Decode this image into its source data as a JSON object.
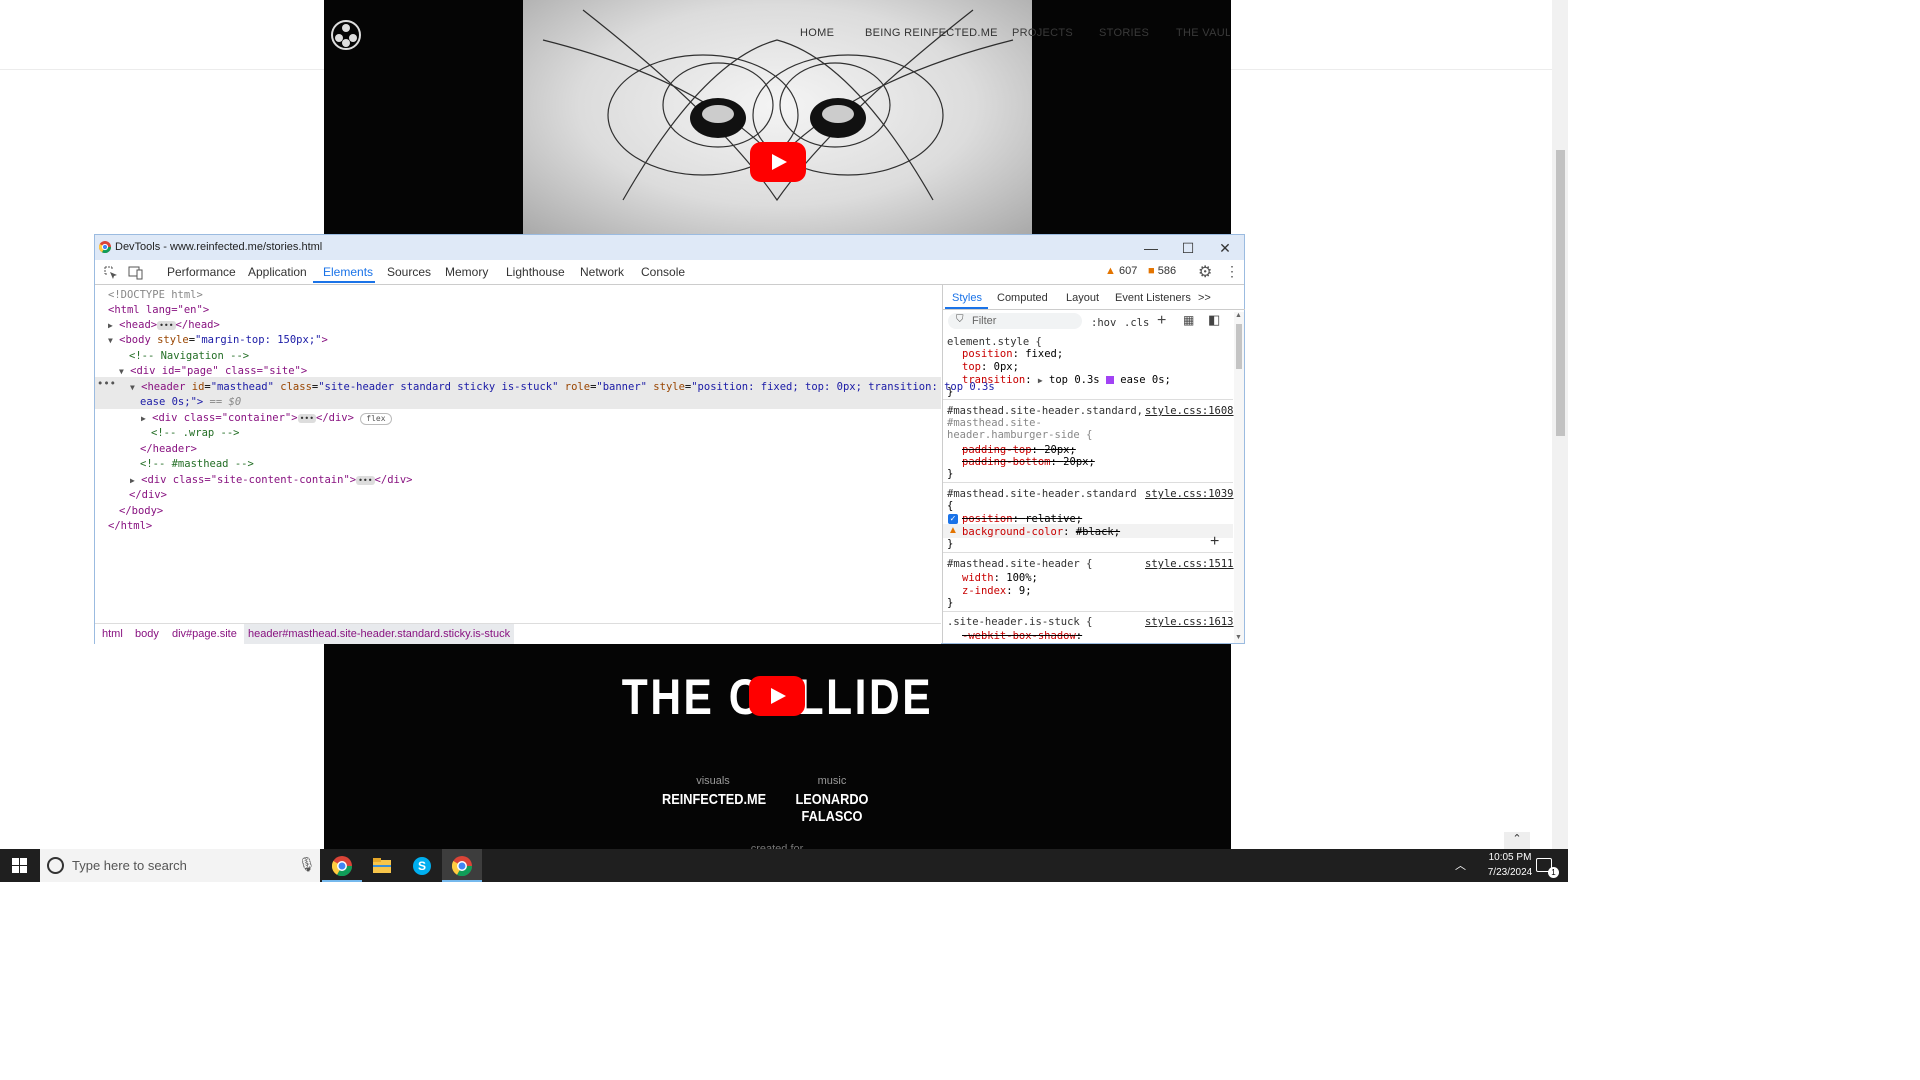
{
  "site": {
    "nav": [
      "HOME",
      "BEING REINFECTED.ME",
      "PROJECTS",
      "STORIES",
      "THE VAULT"
    ],
    "video2": {
      "title": "THE COLLIDE",
      "credits": [
        {
          "role": "visuals",
          "name": "REINFECTED.ME"
        },
        {
          "role": "music",
          "name": "LEONARDO FALASCO"
        }
      ],
      "created_for": "created for"
    }
  },
  "devtools": {
    "window_title": "DevTools - www.reinfected.me/stories.html",
    "tabs": [
      "Performance",
      "Application",
      "Elements",
      "Sources",
      "Memory",
      "Lighthouse",
      "Network",
      "Console"
    ],
    "active_tab": "Elements",
    "warnings_count": "607",
    "issues_count": "586",
    "dom": {
      "doctype": "<!DOCTYPE html>",
      "html_open": "<html lang=\"en\">",
      "head": "<head>",
      "head_close": "</head>",
      "body_open_tag": "<body",
      "body_attr": "style",
      "body_val": "\"margin-top: 150px;\"",
      "comment_nav": "<!-- Navigation -->",
      "div_page": "<div id=\"page\" class=\"site\">",
      "header_tag": "<header",
      "header_id_attr": "id",
      "header_id_val": "\"masthead\"",
      "header_class_attr": "class",
      "header_class_val": "\"site-header standard sticky is-stuck\"",
      "header_role_attr": "role",
      "header_role_val": "\"banner\"",
      "header_style_attr": "style",
      "header_style_val": "\"position: fixed; top: 0px; transition: top 0.3s",
      "header_style_val2": "ease 0s;\">",
      "selected_marker": "== $0",
      "div_container": "<div class=\"container\">",
      "div_close": "</div>",
      "flex_badge": "flex",
      "comment_wrap": "<!-- .wrap -->",
      "header_close": "</header>",
      "comment_masthead": "<!-- #masthead -->",
      "div_content": "<div class=\"site-content-contain\">",
      "div_close2": "</div>",
      "body_close": "</body>",
      "html_close": "</html>"
    },
    "breadcrumb": [
      "html",
      "body",
      "div#page.site",
      "header#masthead.site-header.standard.sticky.is-stuck"
    ],
    "styles": {
      "tabs": [
        "Styles",
        "Computed",
        "Layout",
        "Event Listeners"
      ],
      "more": ">>",
      "filter_placeholder": "Filter",
      "hov": ":hov",
      "cls": ".cls",
      "rules": {
        "element_style": {
          "selector": "element.style {",
          "props": [
            {
              "name": "position",
              "value": "fixed;"
            },
            {
              "name": "top",
              "value": "0px;"
            },
            {
              "name": "transition",
              "value": "top 0.3s",
              "value2": "ease 0s;"
            }
          ]
        },
        "rule2": {
          "selector1": "#masthead.site-header.standard,",
          "selector2": "#masthead.site-",
          "selector3": "header.hamburger-side {",
          "source": "style.css:1608",
          "props": [
            {
              "name": "padding-top",
              "value": "20px;"
            },
            {
              "name": "padding-bottom",
              "value": "20px;"
            }
          ]
        },
        "rule3": {
          "selector": "#masthead.site-header.standard",
          "brace": "{",
          "source": "style.css:1039",
          "props": [
            {
              "name": "position",
              "value": "relative;"
            },
            {
              "name": "background-color",
              "value": "#black;"
            }
          ]
        },
        "rule4": {
          "selector": "#masthead.site-header {",
          "source": "style.css:1511",
          "props": [
            {
              "name": "width",
              "value": "100%;"
            },
            {
              "name": "z-index",
              "value": "9;"
            }
          ]
        },
        "rule5": {
          "selector": ".site-header.is-stuck {",
          "source": "style.css:1613",
          "props": [
            {
              "name": "-webkit-box-shadow",
              "value": ""
            }
          ]
        },
        "close_brace": "}"
      }
    }
  },
  "taskbar": {
    "search_placeholder": "Type here to search",
    "time": "10:05 PM",
    "date": "7/23/2024",
    "notification_count": "1"
  }
}
